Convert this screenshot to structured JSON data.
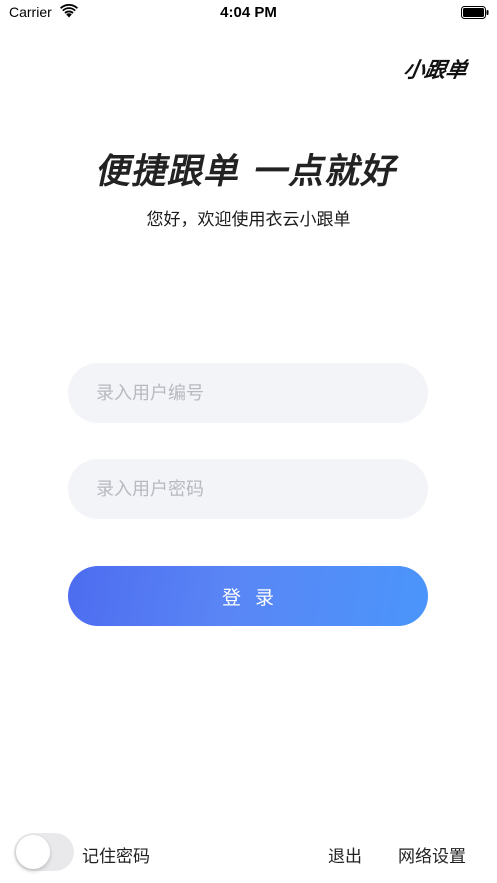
{
  "status_bar": {
    "carrier": "Carrier",
    "time": "4:04 PM",
    "icons": [
      "wifi-icon",
      "battery-icon"
    ]
  },
  "header": {
    "logo_text": "小跟单",
    "slogan": "便捷跟单 一点就好",
    "welcome": "您好，欢迎使用衣云小跟单"
  },
  "form": {
    "username_placeholder": "录入用户编号",
    "username_value": "",
    "password_placeholder": "录入用户密码",
    "password_value": "",
    "login_label": "登录"
  },
  "footer": {
    "remember_label": "记住密码",
    "remember_checked": false,
    "logout_label": "退出",
    "network_label": "网络设置"
  },
  "colors": {
    "accent": "#4d6cf0",
    "accent_end": "#4a95fb",
    "input_bg": "#f3f4f8"
  }
}
